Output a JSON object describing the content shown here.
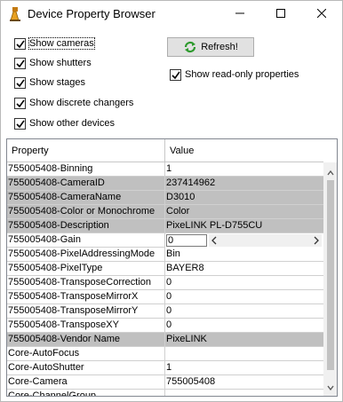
{
  "window": {
    "title": "Device Property Browser"
  },
  "options": {
    "checkboxes": [
      {
        "label": "Show cameras",
        "checked": true
      },
      {
        "label": "Show shutters",
        "checked": true
      },
      {
        "label": "Show stages",
        "checked": true
      },
      {
        "label": "Show discrete changers",
        "checked": true
      },
      {
        "label": "Show other devices",
        "checked": true
      }
    ],
    "refresh_label": "Refresh!",
    "readonly": {
      "label": "Show read-only properties",
      "checked": true
    }
  },
  "table": {
    "headers": {
      "property": "Property",
      "value": "Value"
    },
    "readonly_color": "#c0c0c0",
    "rows": [
      {
        "property": "755005408-Binning",
        "value": "1",
        "readonly": false
      },
      {
        "property": "755005408-CameraID",
        "value": "237414962",
        "readonly": true
      },
      {
        "property": "755005408-CameraName",
        "value": "D3010",
        "readonly": true
      },
      {
        "property": "755005408-Color or Monochrome",
        "value": "Color",
        "readonly": true
      },
      {
        "property": "755005408-Description",
        "value": "PixeLINK PL-D755CU",
        "readonly": true
      },
      {
        "property": "755005408-Gain",
        "value": "0",
        "readonly": false,
        "slider": true
      },
      {
        "property": "755005408-PixelAddressingMode",
        "value": "Bin",
        "readonly": false
      },
      {
        "property": "755005408-PixelType",
        "value": "BAYER8",
        "readonly": false
      },
      {
        "property": "755005408-TransposeCorrection",
        "value": "0",
        "readonly": false
      },
      {
        "property": "755005408-TransposeMirrorX",
        "value": "0",
        "readonly": false
      },
      {
        "property": "755005408-TransposeMirrorY",
        "value": "0",
        "readonly": false
      },
      {
        "property": "755005408-TransposeXY",
        "value": "0",
        "readonly": false
      },
      {
        "property": "755005408-Vendor Name",
        "value": "PixeLINK",
        "readonly": true
      },
      {
        "property": "Core-AutoFocus",
        "value": "",
        "readonly": false
      },
      {
        "property": "Core-AutoShutter",
        "value": "1",
        "readonly": false
      },
      {
        "property": "Core-Camera",
        "value": "755005408",
        "readonly": false
      },
      {
        "property": "Core-ChannelGroup",
        "value": "",
        "readonly": false
      }
    ]
  }
}
